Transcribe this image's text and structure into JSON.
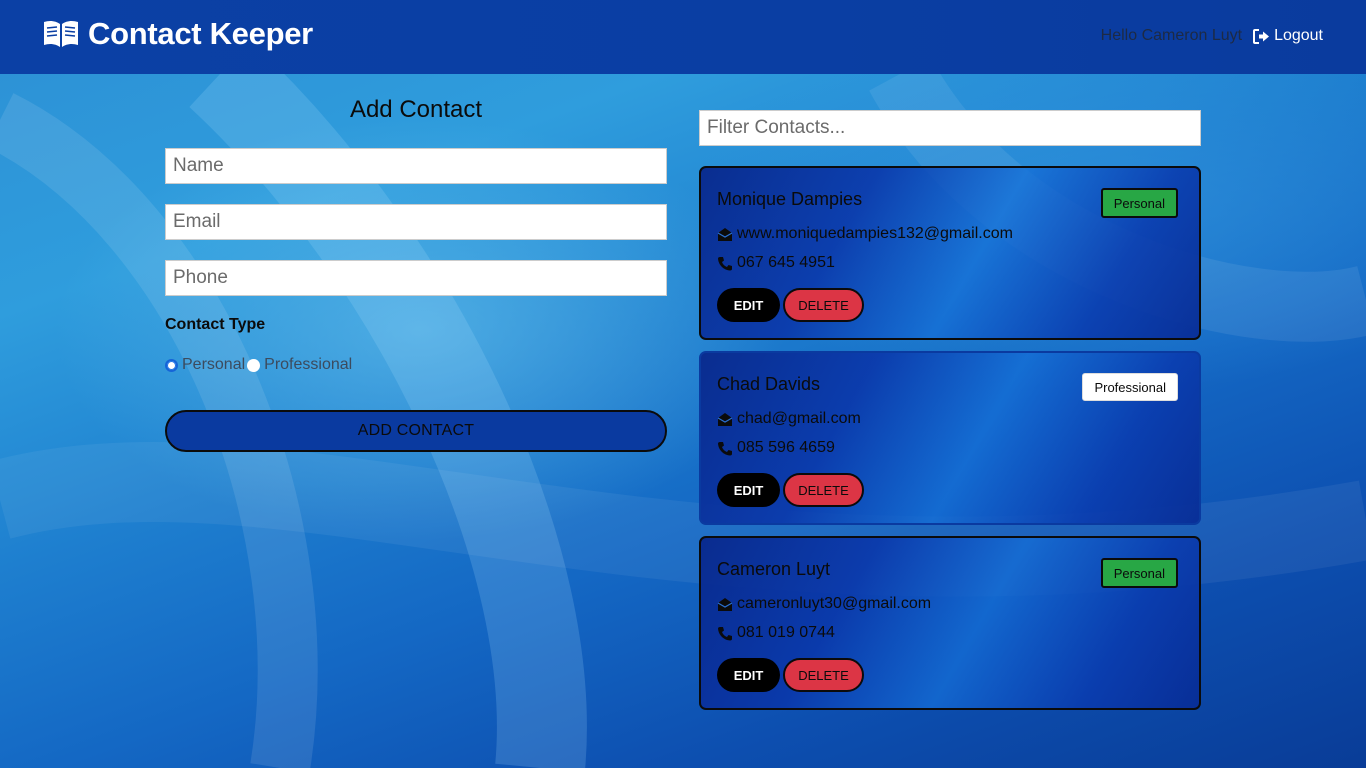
{
  "navbar": {
    "brand_title": "Contact Keeper",
    "brand_icon": "book-open-icon",
    "greeting": "Hello Cameron Luyt",
    "logout_label": "Logout",
    "logout_icon": "sign-out-icon"
  },
  "form": {
    "title": "Add Contact",
    "name_placeholder": "Name",
    "email_placeholder": "Email",
    "phone_placeholder": "Phone",
    "type_label": "Contact Type",
    "option_personal": "Personal",
    "option_professional": "Professional",
    "selected_type": "Personal",
    "submit_label": "ADD CONTACT"
  },
  "filter": {
    "placeholder": "Filter Contacts..."
  },
  "contacts": [
    {
      "name": "Monique Dampies",
      "type": "Personal",
      "email": "www.moniquedampies132@gmail.com",
      "phone": "067 645 4951",
      "edit_label": "EDIT",
      "delete_label": "DELETE"
    },
    {
      "name": "Chad Davids",
      "type": "Professional",
      "email": "chad@gmail.com",
      "phone": "085 596 4659",
      "edit_label": "EDIT",
      "delete_label": "DELETE"
    },
    {
      "name": "Cameron Luyt",
      "type": "Personal",
      "email": "cameronluyt30@gmail.com",
      "phone": "081 019 0744",
      "edit_label": "EDIT",
      "delete_label": "DELETE"
    }
  ],
  "colors": {
    "navbar": "#0a3ea3",
    "primary_button": "#0a3aa0",
    "personal_badge": "#28a745",
    "professional_badge": "#ffffff",
    "delete_button": "#dc3545",
    "edit_button": "#000000"
  }
}
